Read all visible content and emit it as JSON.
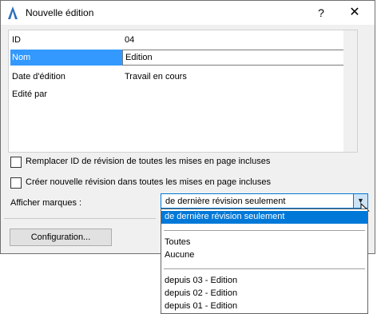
{
  "window": {
    "title": "Nouvelle édition",
    "help_label": "?",
    "close_label": "✕",
    "app_icon": "archicad-icon"
  },
  "properties": [
    {
      "label": "ID",
      "value": "04"
    },
    {
      "label": "Nom",
      "value": "Edition"
    },
    {
      "label": "Date d'édition",
      "value": "Travail en cours"
    },
    {
      "label": "Edité par",
      "value": ""
    }
  ],
  "options": {
    "replace_id_label": "Remplacer ID de révision de toutes les mises en page incluses",
    "replace_id_checked": false,
    "create_revision_label": "Créer nouvelle révision dans toutes les mises en page incluses",
    "create_revision_checked": false
  },
  "show_marks": {
    "label": "Afficher marques :",
    "selected": "de dernière révision seulement",
    "options_group1": [
      "de dernière révision seulement"
    ],
    "options_group2": [
      "Toutes",
      "Aucune"
    ],
    "options_group3": [
      "depuis 03 - Edition",
      "depuis 02 - Edition",
      "depuis 01 - Edition"
    ]
  },
  "buttons": {
    "configuration_label": "Configuration..."
  },
  "colors": {
    "selection": "#3399ff",
    "dropdown_highlight": "#0078d7",
    "combo_border": "#0078d7"
  }
}
